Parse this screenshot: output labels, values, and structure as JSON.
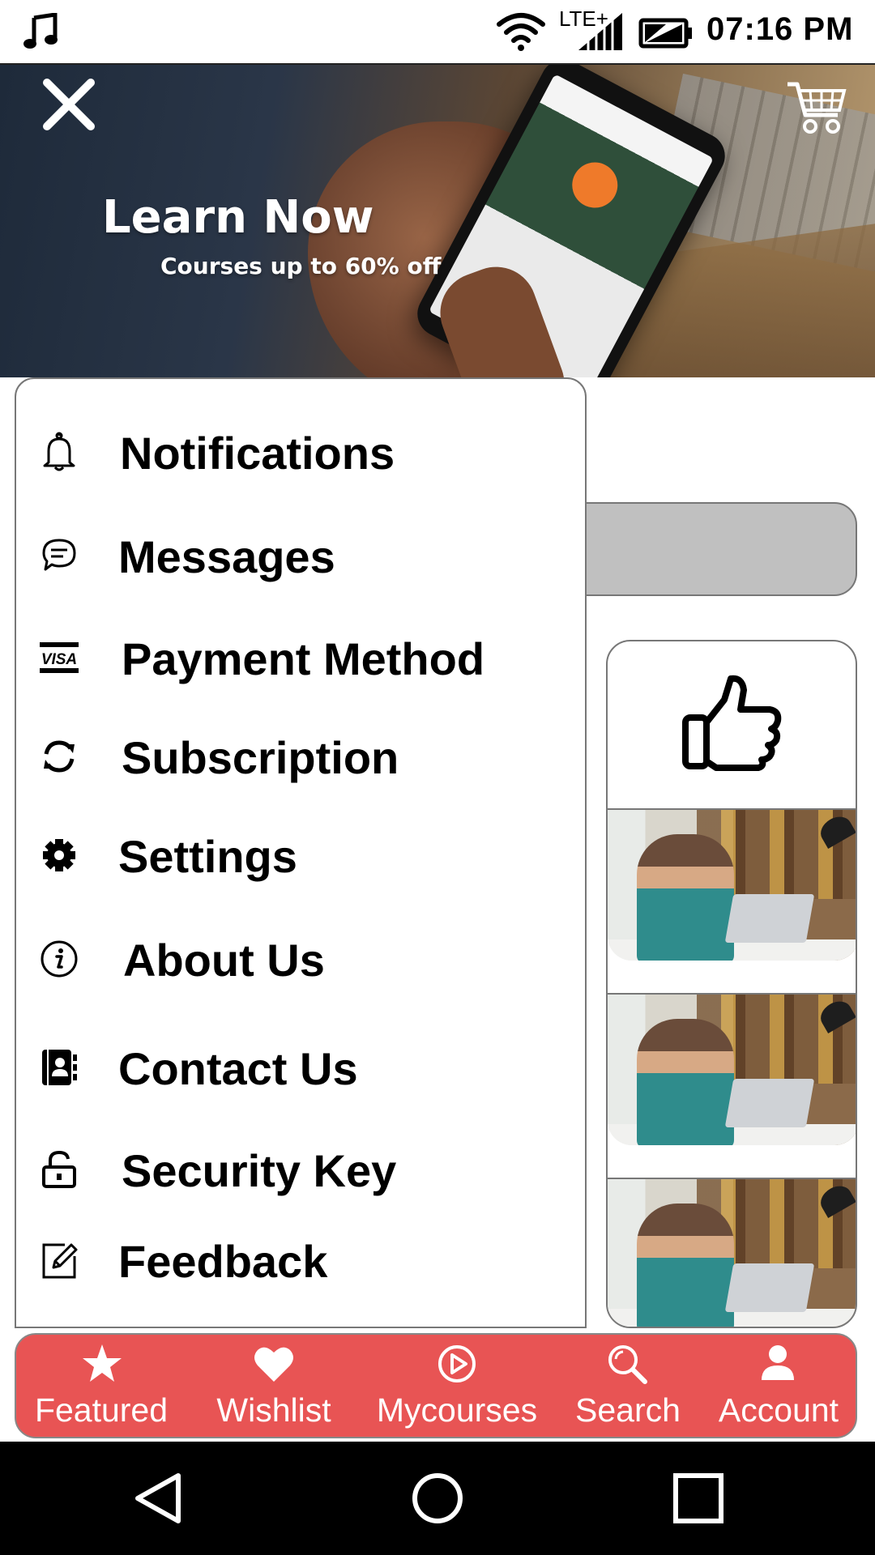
{
  "status_bar": {
    "network_label": "LTE+",
    "time": "07:16 PM",
    "icons": [
      "music-note-icon",
      "wifi-icon",
      "signal-icon",
      "battery-icon"
    ]
  },
  "hero": {
    "title": "Learn Now",
    "subtitle": "Courses up to 60% off",
    "icons": [
      "close-icon",
      "cart-icon"
    ]
  },
  "drawer": {
    "items": [
      {
        "label": "Notifications",
        "icon": "bell-icon"
      },
      {
        "label": "Messages",
        "icon": "chat-bubble-icon"
      },
      {
        "label": "Payment Method",
        "icon": "visa-card-icon"
      },
      {
        "label": "Subscription",
        "icon": "refresh-icon"
      },
      {
        "label": "Settings",
        "icon": "gear-icon"
      },
      {
        "label": "About Us",
        "icon": "info-icon"
      },
      {
        "label": "Contact Us",
        "icon": "address-book-icon"
      },
      {
        "label": "Security Key",
        "icon": "unlock-icon"
      },
      {
        "label": "Feedback",
        "icon": "edit-icon"
      }
    ]
  },
  "bottom_nav": {
    "items": [
      {
        "label": "Featured",
        "icon": "star-icon"
      },
      {
        "label": "Wishlist",
        "icon": "heart-icon"
      },
      {
        "label": "Mycourses",
        "icon": "play-circle-icon"
      },
      {
        "label": "Search",
        "icon": "search-icon"
      },
      {
        "label": "Account",
        "icon": "user-icon"
      }
    ]
  },
  "system_nav": {
    "icons": [
      "back-icon",
      "home-icon",
      "recents-icon"
    ]
  },
  "colors": {
    "nav_background": "#e85454",
    "search_bar": "#c0c0c0",
    "drawer_border": "#777777"
  }
}
